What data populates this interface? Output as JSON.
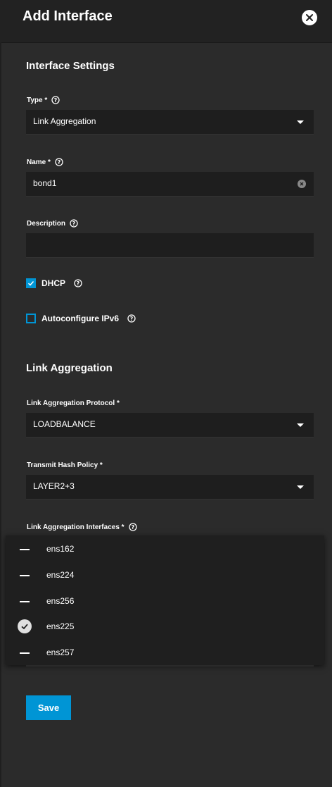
{
  "header": {
    "title": "Add Interface"
  },
  "sections": {
    "interface_settings": "Interface Settings",
    "link_aggregation": "Link Aggregation"
  },
  "fields": {
    "type": {
      "label": "Type *",
      "value": "Link Aggregation"
    },
    "name": {
      "label": "Name *",
      "value": "bond1"
    },
    "description": {
      "label": "Description",
      "value": ""
    },
    "lag_protocol": {
      "label": "Link Aggregation Protocol *",
      "value": "LOADBALANCE"
    },
    "hash_policy": {
      "label": "Transmit Hash Policy *",
      "value": "LAYER2+3"
    },
    "lag_interfaces": {
      "label": "Link Aggregation Interfaces *"
    }
  },
  "checkboxes": {
    "dhcp": {
      "label": "DHCP",
      "checked": true
    },
    "ipv6": {
      "label": "Autoconfigure IPv6",
      "checked": false
    }
  },
  "interfaces": [
    {
      "name": "ens162",
      "selected": false
    },
    {
      "name": "ens224",
      "selected": false
    },
    {
      "name": "ens256",
      "selected": false
    },
    {
      "name": "ens225",
      "selected": true
    },
    {
      "name": "ens257",
      "selected": false
    }
  ],
  "actions": {
    "save_label": "Save"
  },
  "colors": {
    "accent": "#0095d5",
    "background": "#2b2b2b",
    "field": "#1e1e1e"
  },
  "icons": {
    "close": "close-icon",
    "help": "help-icon",
    "dropdown": "chevron-down-icon",
    "clear": "clear-icon",
    "check": "check-icon"
  }
}
